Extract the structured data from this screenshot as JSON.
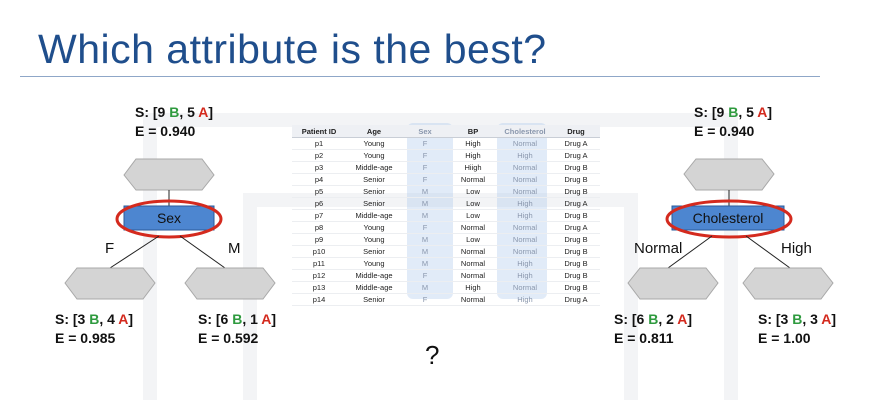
{
  "slide": {
    "title": "Which attribute is the best?",
    "question_mark": "?"
  },
  "left_tree": {
    "root": {
      "s_prefix": "S: [9 ",
      "b": "B",
      "mid": ", 5 ",
      "a": "A",
      "suffix": "]",
      "e": "E = 0.940"
    },
    "node_label": "Sex",
    "branch_left": "F",
    "branch_right": "M",
    "leaf_left": {
      "s_prefix": "S: [3 ",
      "b": "B",
      "mid": ", 4 ",
      "a": "A",
      "suffix": "]",
      "e": "E = 0.985"
    },
    "leaf_right": {
      "s_prefix": "S: [6 ",
      "b": "B",
      "mid": ", 1 ",
      "a": "A",
      "suffix": "]",
      "e": "E = 0.592"
    }
  },
  "right_tree": {
    "root": {
      "s_prefix": "S: [9 ",
      "b": "B",
      "mid": ", 5 ",
      "a": "A",
      "suffix": "]",
      "e": "E = 0.940"
    },
    "node_label": "Cholesterol",
    "branch_left": "Normal",
    "branch_right": "High",
    "leaf_left": {
      "s_prefix": "S: [6 ",
      "b": "B",
      "mid": ", 2 ",
      "a": "A",
      "suffix": "]",
      "e": "E = 0.811"
    },
    "leaf_right": {
      "s_prefix": "S: [3 ",
      "b": "B",
      "mid": ", 3 ",
      "a": "A",
      "suffix": "]",
      "e": "E = 1.00"
    }
  },
  "table": {
    "headers": [
      "Patient ID",
      "Age",
      "Sex",
      "BP",
      "Cholesterol",
      "Drug"
    ],
    "rows": [
      [
        "p1",
        "Young",
        "F",
        "High",
        "Normal",
        "Drug A"
      ],
      [
        "p2",
        "Young",
        "F",
        "High",
        "High",
        "Drug A"
      ],
      [
        "p3",
        "Middle-age",
        "F",
        "Hiigh",
        "Normal",
        "Drug B"
      ],
      [
        "p4",
        "Senior",
        "F",
        "Normal",
        "Normal",
        "Drug B"
      ],
      [
        "p5",
        "Senior",
        "M",
        "Low",
        "Normal",
        "Drug B"
      ],
      [
        "p6",
        "Senior",
        "M",
        "Low",
        "High",
        "Drug A"
      ],
      [
        "p7",
        "Middle-age",
        "M",
        "Low",
        "High",
        "Drug B"
      ],
      [
        "p8",
        "Young",
        "F",
        "Normal",
        "Normal",
        "Drug A"
      ],
      [
        "p9",
        "Young",
        "M",
        "Low",
        "Normal",
        "Drug B"
      ],
      [
        "p10",
        "Senior",
        "M",
        "Normal",
        "Normal",
        "Drug B"
      ],
      [
        "p11",
        "Young",
        "M",
        "Normal",
        "High",
        "Drug B"
      ],
      [
        "p12",
        "Middle-age",
        "F",
        "Normal",
        "High",
        "Drug B"
      ],
      [
        "p13",
        "Middle-age",
        "M",
        "High",
        "Normal",
        "Drug B"
      ],
      [
        "p14",
        "Senior",
        "F",
        "Normal",
        "High",
        "Drug A"
      ]
    ]
  },
  "colors": {
    "title": "#1f4e8c",
    "b_label": "#2e9a3e",
    "a_label": "#d42a1e",
    "node_fill": "#4d86d0",
    "hexagon_fill": "#d4d4d4",
    "highlight_ellipse": "#d42a1e"
  }
}
